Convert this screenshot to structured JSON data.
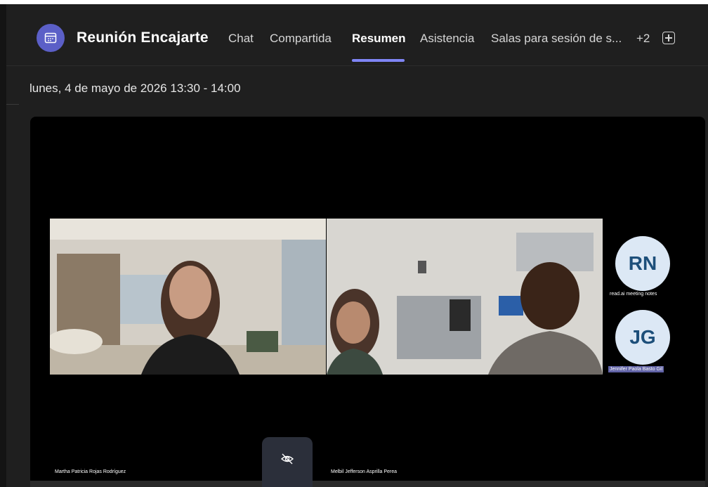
{
  "header": {
    "title": "Reunión Encajarte",
    "tabs": [
      {
        "label": "Chat",
        "active": false
      },
      {
        "label": "Compartida",
        "active": false
      },
      {
        "label": "Resumen",
        "active": true
      },
      {
        "label": "Asistencia",
        "active": false
      },
      {
        "label": "Salas para sesión de s...",
        "active": false
      },
      {
        "label": "+2",
        "active": false
      }
    ],
    "add_tab_icon": "plus-square-icon",
    "meeting_icon": "calendar-icon",
    "accent_color": "#5b5fc7"
  },
  "meeting": {
    "datetime": "lunes, 4 de mayo de 2026 13:30 - 14:00"
  },
  "recording": {
    "participants": [
      {
        "initials": "RN",
        "label": "read.ai meeting notes"
      },
      {
        "initials": "JG",
        "label": "Jennifer Paola Basto Gil"
      }
    ],
    "video_names": [
      "Martha Patricia Rojas Rodríguez",
      "Melbil Jefferson  Asprilla Perea"
    ],
    "controls": {
      "hide_icon": "eye-off-icon",
      "more_label": "..."
    }
  }
}
